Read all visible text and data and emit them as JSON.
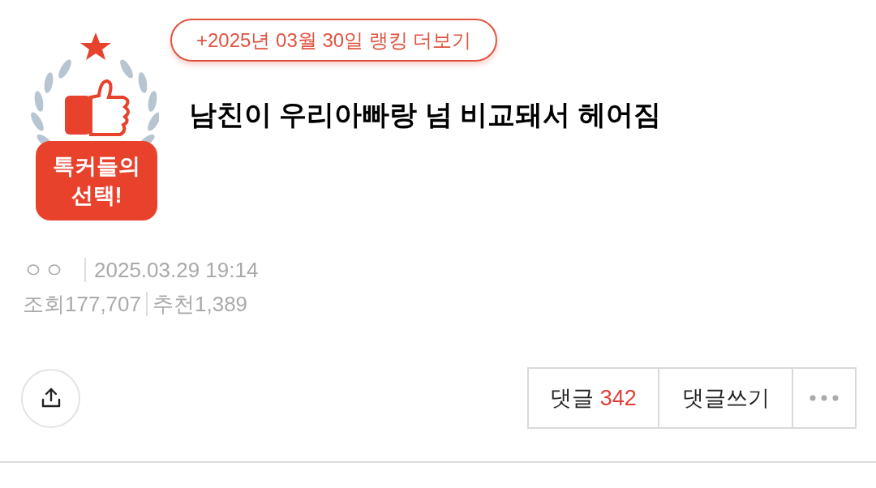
{
  "badge": {
    "line_1": "톡커들의",
    "line_2": "선택!"
  },
  "ranking_link": "+2025년 03월 30일 랭킹 더보기",
  "title": "남친이 우리아빠랑 넘 비교돼서 헤어짐",
  "meta": {
    "author": "ㅇㅇ",
    "datetime": "2025.03.29 19:14",
    "views_label": "조회",
    "views": "177,707",
    "likes_label": "추천",
    "likes": "1,389"
  },
  "actions": {
    "comments_label": "댓글",
    "comments_count": "342",
    "write_comment": "댓글쓰기"
  }
}
